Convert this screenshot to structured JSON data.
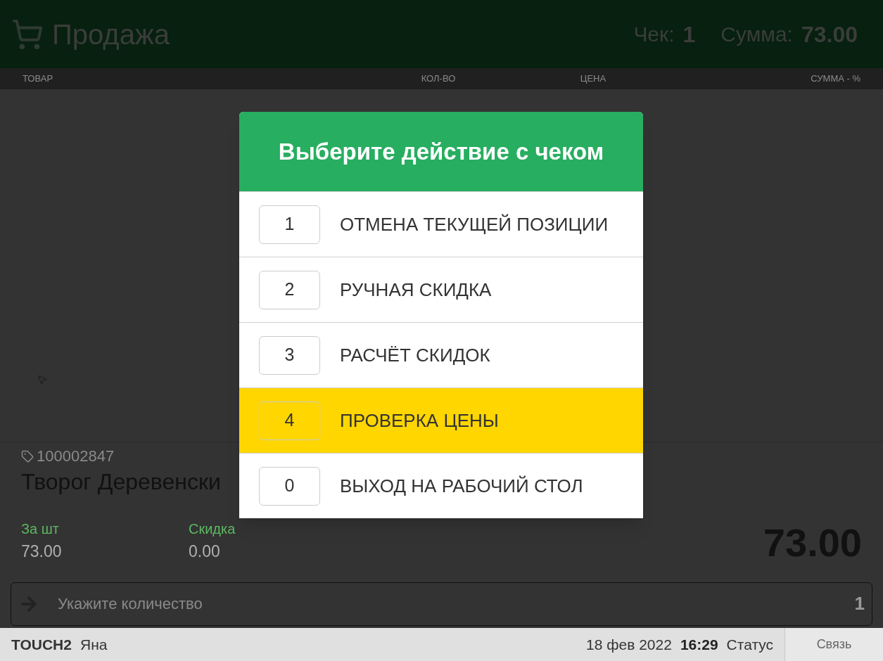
{
  "header": {
    "title": "Продажа",
    "receipt_label": "Чек:",
    "receipt_number": "1",
    "sum_label": "Сумма:",
    "sum_value": "73.00"
  },
  "table": {
    "columns": [
      "ТОВАР",
      "КОЛ-ВО",
      "ЦЕНА",
      "СУММА - %"
    ]
  },
  "product": {
    "code": "100002847",
    "name": "Творог Деревенски",
    "price_label": "За шт",
    "price": "73.00",
    "discount_label": "Скидка",
    "discount": "0.00",
    "total": "73.00"
  },
  "quantity_field": {
    "placeholder": "Укажите количество",
    "value": "1"
  },
  "dialog": {
    "title": "Выберите действие с чеком",
    "items": [
      {
        "key": "1",
        "label": "ОТМЕНА ТЕКУЩЕЙ ПОЗИЦИИ",
        "selected": false
      },
      {
        "key": "2",
        "label": "РУЧНАЯ СКИДКА",
        "selected": false
      },
      {
        "key": "3",
        "label": "РАСЧЁТ СКИДОК",
        "selected": false
      },
      {
        "key": "4",
        "label": "ПРОВЕРКА ЦЕНЫ",
        "selected": true
      },
      {
        "key": "0",
        "label": "ВЫХОД НА РАБОЧИЙ СТОЛ",
        "selected": false
      }
    ]
  },
  "status_bar": {
    "terminal": "TOUCH2",
    "user": "Яна",
    "date": "18 фев 2022",
    "time": "16:29",
    "status": "Статус",
    "connection_button": "Связь"
  }
}
